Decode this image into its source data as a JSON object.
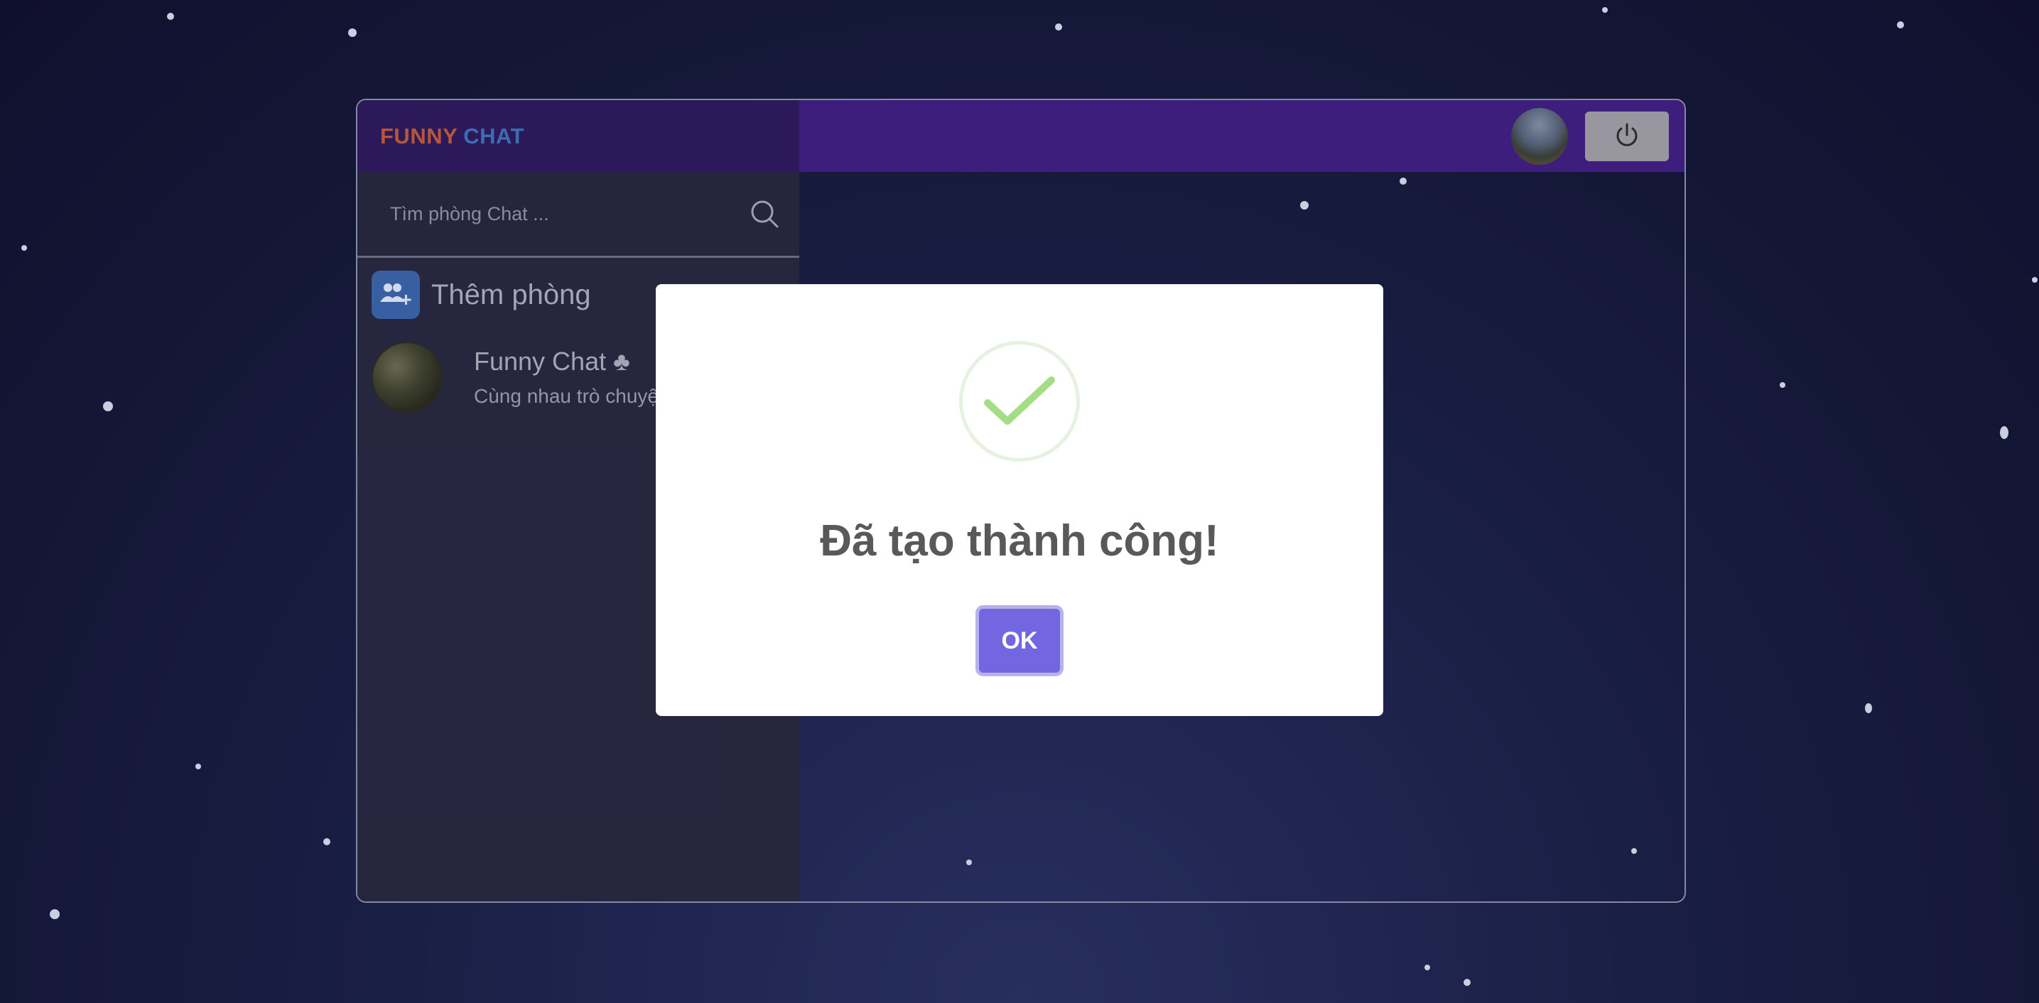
{
  "app": {
    "brand_part1": "FUNNY",
    "brand_part2": "CHAT"
  },
  "sidebar": {
    "search_placeholder": "Tìm phòng Chat ...",
    "add_room_label": "Thêm phòng",
    "rooms": [
      {
        "name": "Funny Chat ♣",
        "description": "Cùng nhau trò chuyệ"
      }
    ]
  },
  "header": {
    "avatar_icon": "user-avatar",
    "power_icon": "power-icon"
  },
  "modal": {
    "icon": "success-check-icon",
    "title": "Đã tạo thành công!",
    "ok_label": "OK"
  },
  "colors": {
    "brand_part1": "#b9593c",
    "brand_part2": "#3f6fb5",
    "header_bg": "#3f1f80",
    "sidebar_header_bg": "#2d1a5c",
    "ok_button": "#7367e1",
    "success_check": "#a5dc86"
  }
}
